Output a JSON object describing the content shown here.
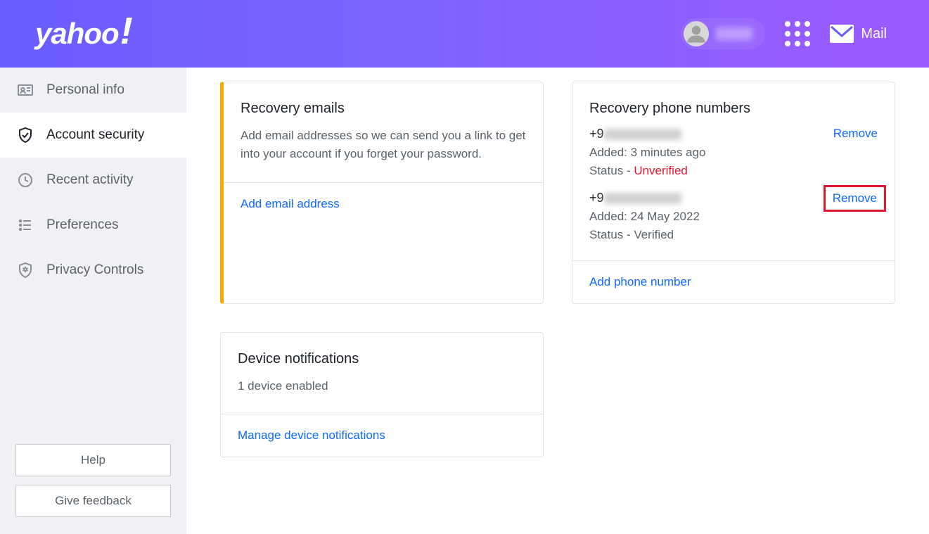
{
  "header": {
    "logo_text": "yahoo",
    "mail_label": "Mail"
  },
  "sidebar": {
    "items": [
      {
        "label": "Personal info"
      },
      {
        "label": "Account security"
      },
      {
        "label": "Recent activity"
      },
      {
        "label": "Preferences"
      },
      {
        "label": "Privacy Controls"
      }
    ],
    "help_label": "Help",
    "feedback_label": "Give feedback"
  },
  "emails": {
    "title": "Recovery emails",
    "desc": "Add email addresses so we can send you a link to get into your account if you forget your password.",
    "action": "Add email address"
  },
  "phones": {
    "title": "Recovery phone numbers",
    "entries": [
      {
        "prefix": "+9",
        "added_label": "Added:",
        "added": "3 minutes ago",
        "status_label": "Status -",
        "status": "Unverified",
        "status_class": "unverified",
        "remove": "Remove"
      },
      {
        "prefix": "+9",
        "added_label": "Added:",
        "added": "24 May 2022",
        "status_label": "Status -",
        "status": "Verified",
        "status_class": "",
        "remove": "Remove"
      }
    ],
    "action": "Add phone number"
  },
  "device": {
    "title": "Device notifications",
    "desc": "1 device enabled",
    "action": "Manage device notifications"
  }
}
